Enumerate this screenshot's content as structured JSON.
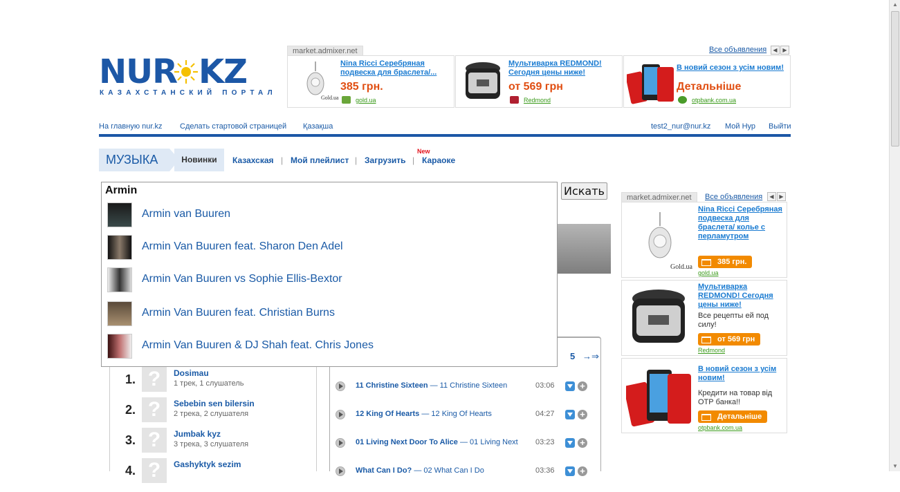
{
  "logo": {
    "word_left": "NUR",
    "word_right": "KZ",
    "tagline": "КАЗАХСТАНСКИЙ ПОРТАЛ"
  },
  "top_ads": {
    "tab": "market.admixer.net",
    "all_link": "Все объявления",
    "items": [
      {
        "title": "Nina Ricci Серебряная подвеска для браслета/...",
        "price": "385 грн.",
        "source": "gold.ua"
      },
      {
        "title": "Мультиварка REDMOND! Сегодня цены ниже!",
        "price": "от 569 грн",
        "source": "Redmond"
      },
      {
        "title": "В новий сезон з усім новим!",
        "price": "Детальніше",
        "source": "otpbank.com.ua"
      }
    ]
  },
  "links": {
    "home": "На главную nur.kz",
    "start_page": "Сделать стартовой страницей",
    "kazakh": "Қазақша",
    "user": "test2_nur@nur.kz",
    "my_nur": "Мой Нур",
    "logout": "Выйти"
  },
  "music_nav": {
    "section": "МУЗЫКА",
    "new": "Новинки",
    "kazakh": "Казахская",
    "playlist": "Мой плейлист",
    "upload": "Загрузить",
    "karaoke": "Караоке",
    "badge": "New"
  },
  "search": {
    "query": "Armin",
    "button": "Искать",
    "suggestions": [
      "Armin van Buuren",
      "Armin Van Buuren feat. Sharon Den Adel",
      "Armin Van Buuren vs Sophie Ellis-Bextor",
      "Armin Van Buuren feat. Christian Burns",
      "Armin Van Buuren & DJ Shah feat. Chris Jones"
    ]
  },
  "artists": [
    {
      "rank": "1.",
      "name": "Dosimau",
      "meta": "1 трек, 1 слушатель"
    },
    {
      "rank": "2.",
      "name": "Sebebin sen bilersin",
      "meta": "2 трека, 2 слушателя"
    },
    {
      "rank": "3.",
      "name": "Jumbak kyz",
      "meta": "3 трека, 3 слушателя"
    },
    {
      "rank": "4.",
      "name": "Gashyktyk sezim",
      "meta": ""
    }
  ],
  "tracks": {
    "page": "5",
    "next": "→⇒",
    "items": [
      {
        "title": "11 Christine Sixteen",
        "album": " — 11 Christine Sixteen",
        "duration": "03:06"
      },
      {
        "title": "12 King Of Hearts",
        "album": " — 12 King Of Hearts",
        "duration": "04:27"
      },
      {
        "title": "01 Living Next Door To Alice",
        "album": " — 01 Living Next",
        "duration": "03:23"
      },
      {
        "title": "What Can I Do?",
        "album": " — 02 What Can I Do",
        "duration": "03:36"
      }
    ]
  },
  "right_ads": {
    "tab": "market.admixer.net",
    "all_link": "Все объявления",
    "items": [
      {
        "title": "Nina Ricci Серебряная подвеска для браслета/ колье с перламутром",
        "desc": "",
        "price": "385 грн.",
        "source": "gold.ua"
      },
      {
        "title": "Мультиварка REDMOND! Сегодня цены ниже!",
        "desc": "Все рецепты ей под силу!",
        "price": "от 569 грн",
        "source": "Redmond"
      },
      {
        "title": "В новий сезон з усім новим!",
        "desc": "Кредити на товар від ОТР банка!!",
        "price": "Детальніше",
        "source": "otpbank.com.ua"
      }
    ]
  },
  "colors": {
    "brand": "#1c57a6",
    "link": "#1a5aa6",
    "price": "#e04e12",
    "button_orange": "#f28a00"
  }
}
